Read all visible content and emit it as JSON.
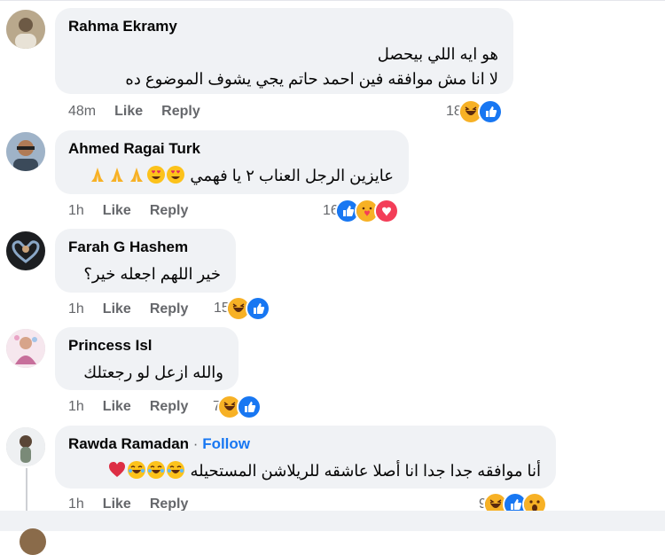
{
  "colors": {
    "accent": "#1877f2",
    "bubble": "#f0f2f5",
    "meta": "#65676b"
  },
  "comments": [
    {
      "author": "Rahma Ekramy",
      "lines": [
        "هو ايه اللي بيحصل",
        "لا انا مش موافقه فين احمد حاتم يجي يشوف الموضوع ده"
      ],
      "time": "48m",
      "like": "Like",
      "reply": "Reply",
      "reaction_count": "18",
      "reactions": [
        "haha",
        "like"
      ]
    },
    {
      "author": "Ahmed Ragai Turk",
      "lines": [
        "عايزين الرجل العناب ٢ يا فهمي"
      ],
      "time": "1h",
      "like": "Like",
      "reply": "Reply",
      "reaction_count": "16",
      "reactions": [
        "like",
        "care",
        "love"
      ]
    },
    {
      "author": "Farah G Hashem",
      "lines": [
        "خير اللهم اجعله خير؟"
      ],
      "time": "1h",
      "like": "Like",
      "reply": "Reply",
      "reaction_count": "15",
      "reactions": [
        "haha",
        "like"
      ]
    },
    {
      "author": "Princess Isl",
      "lines": [
        "والله ازعل لو رجعتلك"
      ],
      "time": "1h",
      "like": "Like",
      "reply": "Reply",
      "reaction_count": "7",
      "reactions": [
        "haha",
        "like"
      ]
    },
    {
      "author": "Rawda Ramadan",
      "follow_sep": "·",
      "follow": "Follow",
      "lines": [
        "أنا موافقه جدا جدا انا أصلا عاشقه للريلاشن المستحيله"
      ],
      "time": "1h",
      "like": "Like",
      "reply": "Reply",
      "reaction_count": "9",
      "reactions": [
        "haha",
        "like",
        "wow"
      ]
    }
  ]
}
